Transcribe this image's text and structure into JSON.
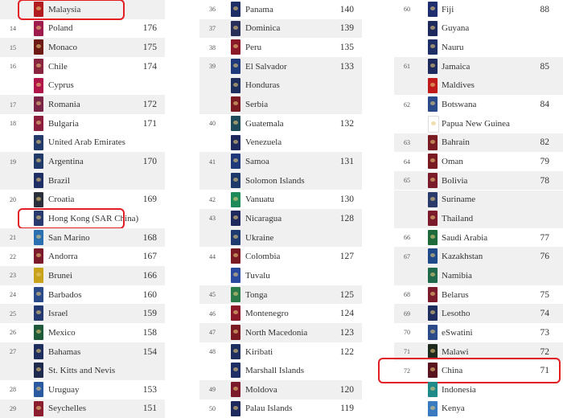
{
  "highlight_color": "#e31e24",
  "columns": [
    {
      "rows": [
        {
          "rank": "",
          "name": "Malaysia",
          "score": "",
          "gray": true,
          "color": "#b01c20",
          "highlight": true
        },
        {
          "rank": "14",
          "name": "Poland",
          "score": "176",
          "gray": false,
          "color": "#9e1b4e"
        },
        {
          "rank": "15",
          "name": "Monaco",
          "score": "175",
          "gray": true,
          "color": "#6e1a14"
        },
        {
          "rank": "16",
          "name": "Chile",
          "score": "174",
          "gray": false,
          "color": "#8a2540"
        },
        {
          "rank": "",
          "name": "Cyprus",
          "score": "",
          "gray": false,
          "color": "#b0154a"
        },
        {
          "rank": "17",
          "name": "Romania",
          "score": "172",
          "gray": true,
          "color": "#7a2448"
        },
        {
          "rank": "18",
          "name": "Bulgaria",
          "score": "171",
          "gray": false,
          "color": "#8c1f3e"
        },
        {
          "rank": "",
          "name": "United Arab Emirates",
          "score": "",
          "gray": false,
          "color": "#243a6b"
        },
        {
          "rank": "19",
          "name": "Argentina",
          "score": "170",
          "gray": true,
          "color": "#203a6a"
        },
        {
          "rank": "",
          "name": "Brazil",
          "score": "",
          "gray": true,
          "color": "#1f2f66"
        },
        {
          "rank": "20",
          "name": "Croatia",
          "score": "169",
          "gray": false,
          "color": "#2b2f3a"
        },
        {
          "rank": "",
          "name": "Hong Kong (SAR China)",
          "score": "",
          "gray": false,
          "color": "#283a6e",
          "highlight": true
        },
        {
          "rank": "21",
          "name": "San Marino",
          "score": "168",
          "gray": true,
          "color": "#2a6fb0"
        },
        {
          "rank": "22",
          "name": "Andorra",
          "score": "167",
          "gray": false,
          "color": "#7a1a2a"
        },
        {
          "rank": "23",
          "name": "Brunei",
          "score": "166",
          "gray": true,
          "color": "#c7a21a"
        },
        {
          "rank": "24",
          "name": "Barbados",
          "score": "160",
          "gray": false,
          "color": "#2a4a8a"
        },
        {
          "rank": "25",
          "name": "Israel",
          "score": "159",
          "gray": true,
          "color": "#253a70"
        },
        {
          "rank": "26",
          "name": "Mexico",
          "score": "158",
          "gray": false,
          "color": "#1f5a3a"
        },
        {
          "rank": "27",
          "name": "Bahamas",
          "score": "154",
          "gray": true,
          "color": "#1e2e5e"
        },
        {
          "rank": "",
          "name": "St. Kitts and Nevis",
          "score": "",
          "gray": true,
          "color": "#1e2a4e"
        },
        {
          "rank": "28",
          "name": "Uruguay",
          "score": "153",
          "gray": false,
          "color": "#2a5aa0"
        },
        {
          "rank": "29",
          "name": "Seychelles",
          "score": "151",
          "gray": true,
          "color": "#8a1e2e"
        }
      ]
    },
    {
      "rows": [
        {
          "rank": "36",
          "name": "Panama",
          "score": "140",
          "gray": false,
          "color": "#1e2e66"
        },
        {
          "rank": "37",
          "name": "Dominica",
          "score": "139",
          "gray": true,
          "color": "#2a2f5a"
        },
        {
          "rank": "38",
          "name": "Peru",
          "score": "135",
          "gray": false,
          "color": "#8a1a2a"
        },
        {
          "rank": "39",
          "name": "El Salvador",
          "score": "133",
          "gray": true,
          "color": "#1e3a7a"
        },
        {
          "rank": "",
          "name": "Honduras",
          "score": "",
          "gray": true,
          "color": "#1e2e5e"
        },
        {
          "rank": "",
          "name": "Serbia",
          "score": "",
          "gray": true,
          "color": "#7a1a22"
        },
        {
          "rank": "40",
          "name": "Guatemala",
          "score": "132",
          "gray": false,
          "color": "#1f4a5a"
        },
        {
          "rank": "",
          "name": "Venezuela",
          "score": "",
          "gray": false,
          "color": "#1e2a5e"
        },
        {
          "rank": "41",
          "name": "Samoa",
          "score": "131",
          "gray": true,
          "color": "#1e3a7a"
        },
        {
          "rank": "",
          "name": "Solomon Islands",
          "score": "",
          "gray": true,
          "color": "#1e3a6a"
        },
        {
          "rank": "42",
          "name": "Vanuatu",
          "score": "130",
          "gray": false,
          "color": "#1e8a5a"
        },
        {
          "rank": "43",
          "name": "Nicaragua",
          "score": "128",
          "gray": true,
          "color": "#1e2a5e"
        },
        {
          "rank": "",
          "name": "Ukraine",
          "score": "",
          "gray": true,
          "color": "#1e3a6e"
        },
        {
          "rank": "44",
          "name": "Colombia",
          "score": "127",
          "gray": false,
          "color": "#7a1a22"
        },
        {
          "rank": "",
          "name": "Tuvalu",
          "score": "",
          "gray": false,
          "color": "#2a4aa0"
        },
        {
          "rank": "45",
          "name": "Tonga",
          "score": "125",
          "gray": true,
          "color": "#2a7a4a"
        },
        {
          "rank": "46",
          "name": "Montenegro",
          "score": "124",
          "gray": false,
          "color": "#8a1a2a"
        },
        {
          "rank": "47",
          "name": "North Macedonia",
          "score": "123",
          "gray": true,
          "color": "#7a1a22"
        },
        {
          "rank": "48",
          "name": "Kiribati",
          "score": "122",
          "gray": false,
          "color": "#1e2e5e"
        },
        {
          "rank": "",
          "name": "Marshall Islands",
          "score": "",
          "gray": false,
          "color": "#1e2e66"
        },
        {
          "rank": "49",
          "name": "Moldova",
          "score": "120",
          "gray": true,
          "color": "#7a1a2a"
        },
        {
          "rank": "50",
          "name": "Palau Islands",
          "score": "119",
          "gray": false,
          "color": "#1e2a5e"
        }
      ]
    },
    {
      "rows": [
        {
          "rank": "60",
          "name": "Fiji",
          "score": "88",
          "gray": false,
          "color": "#1e2e6e"
        },
        {
          "rank": "",
          "name": "Guyana",
          "score": "",
          "gray": false,
          "color": "#1e2a5e"
        },
        {
          "rank": "",
          "name": "Nauru",
          "score": "",
          "gray": false,
          "color": "#1e2e66"
        },
        {
          "rank": "61",
          "name": "Jamaica",
          "score": "85",
          "gray": true,
          "color": "#1e2a5e"
        },
        {
          "rank": "",
          "name": "Maldives",
          "score": "",
          "gray": true,
          "color": "#c01a1a"
        },
        {
          "rank": "62",
          "name": "Botswana",
          "score": "84",
          "gray": false,
          "color": "#2a4a8a"
        },
        {
          "rank": "",
          "name": "Papua New Guinea",
          "score": "",
          "gray": false,
          "color": "#ffffff"
        },
        {
          "rank": "63",
          "name": "Bahrain",
          "score": "82",
          "gray": true,
          "color": "#7a1a22"
        },
        {
          "rank": "64",
          "name": "Oman",
          "score": "79",
          "gray": false,
          "color": "#7a1a22"
        },
        {
          "rank": "65",
          "name": "Bolivia",
          "score": "78",
          "gray": true,
          "color": "#7a1a2a"
        },
        {
          "rank": "",
          "name": "Suriname",
          "score": "",
          "gray": true,
          "color": "#2a3a6a"
        },
        {
          "rank": "",
          "name": "Thailand",
          "score": "",
          "gray": true,
          "color": "#7a1a2a"
        },
        {
          "rank": "66",
          "name": "Saudi Arabia",
          "score": "77",
          "gray": false,
          "color": "#1e6a3a"
        },
        {
          "rank": "67",
          "name": "Kazakhstan",
          "score": "76",
          "gray": true,
          "color": "#1e4a8a"
        },
        {
          "rank": "",
          "name": "Namibia",
          "score": "",
          "gray": true,
          "color": "#1e6a4a"
        },
        {
          "rank": "68",
          "name": "Belarus",
          "score": "75",
          "gray": false,
          "color": "#7a1a2a"
        },
        {
          "rank": "69",
          "name": "Lesotho",
          "score": "74",
          "gray": true,
          "color": "#1e2e5e"
        },
        {
          "rank": "70",
          "name": "eSwatini",
          "score": "73",
          "gray": false,
          "color": "#2a4a8a"
        },
        {
          "rank": "71",
          "name": "Malawi",
          "score": "72",
          "gray": true,
          "color": "#1e2a1e"
        },
        {
          "rank": "72",
          "name": "China",
          "score": "71",
          "gray": false,
          "color": "#5a1420",
          "highlight": true
        },
        {
          "rank": "",
          "name": "Indonesia",
          "score": "",
          "gray": false,
          "color": "#1e8a8a"
        },
        {
          "rank": "",
          "name": "Kenya",
          "score": "",
          "gray": false,
          "color": "#3a7ac0"
        }
      ]
    }
  ]
}
